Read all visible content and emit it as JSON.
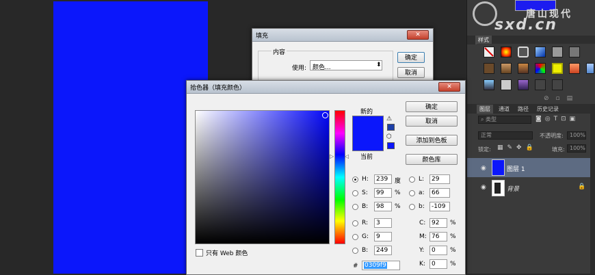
{
  "watermark": {
    "line1": "唐山现代",
    "line2": "sxd.cn"
  },
  "panels": {
    "styles_tab": "样式",
    "layer_tabs": [
      "图层",
      "通道",
      "路径",
      "历史记录"
    ],
    "kind_label": "类型",
    "blend_mode": "正常",
    "opacity_label": "不透明度:",
    "opacity_value": "100%",
    "lock_label": "锁定:",
    "fill_label": "填充:",
    "fill_value": "100%",
    "layers": [
      {
        "name": "图层 1",
        "selected": true
      },
      {
        "name": "背景",
        "locked": true
      }
    ]
  },
  "fill_dialog": {
    "title": "填充",
    "group_label": "内容",
    "use_label": "使用:",
    "use_value": "颜色...",
    "ok": "确定",
    "cancel": "取消"
  },
  "picker": {
    "title": "拾色器（填充颜色）",
    "new_label": "新的",
    "current_label": "当前",
    "ok": "确定",
    "cancel": "取消",
    "add_swatch": "添加到色板",
    "color_lib": "颜色库",
    "web_only_label": "只有 Web 颜色",
    "color_hex": "#0b17fb",
    "hsb": [
      {
        "label": "H:",
        "value": "239",
        "unit": "度",
        "selected": true
      },
      {
        "label": "S:",
        "value": "99",
        "unit": "%"
      },
      {
        "label": "B:",
        "value": "98",
        "unit": "%"
      }
    ],
    "rgb": [
      {
        "label": "R:",
        "value": "3"
      },
      {
        "label": "G:",
        "value": "9"
      },
      {
        "label": "B:",
        "value": "249"
      }
    ],
    "lab": [
      {
        "label": "L:",
        "value": "29"
      },
      {
        "label": "a:",
        "value": "66"
      },
      {
        "label": "b:",
        "value": "-109"
      }
    ],
    "cmyk": [
      {
        "label": "C:",
        "value": "92",
        "unit": "%"
      },
      {
        "label": "M:",
        "value": "76",
        "unit": "%"
      },
      {
        "label": "Y:",
        "value": "0",
        "unit": "%"
      },
      {
        "label": "K:",
        "value": "0",
        "unit": "%"
      }
    ],
    "hex_label": "#",
    "hex_value": "0309f9"
  }
}
